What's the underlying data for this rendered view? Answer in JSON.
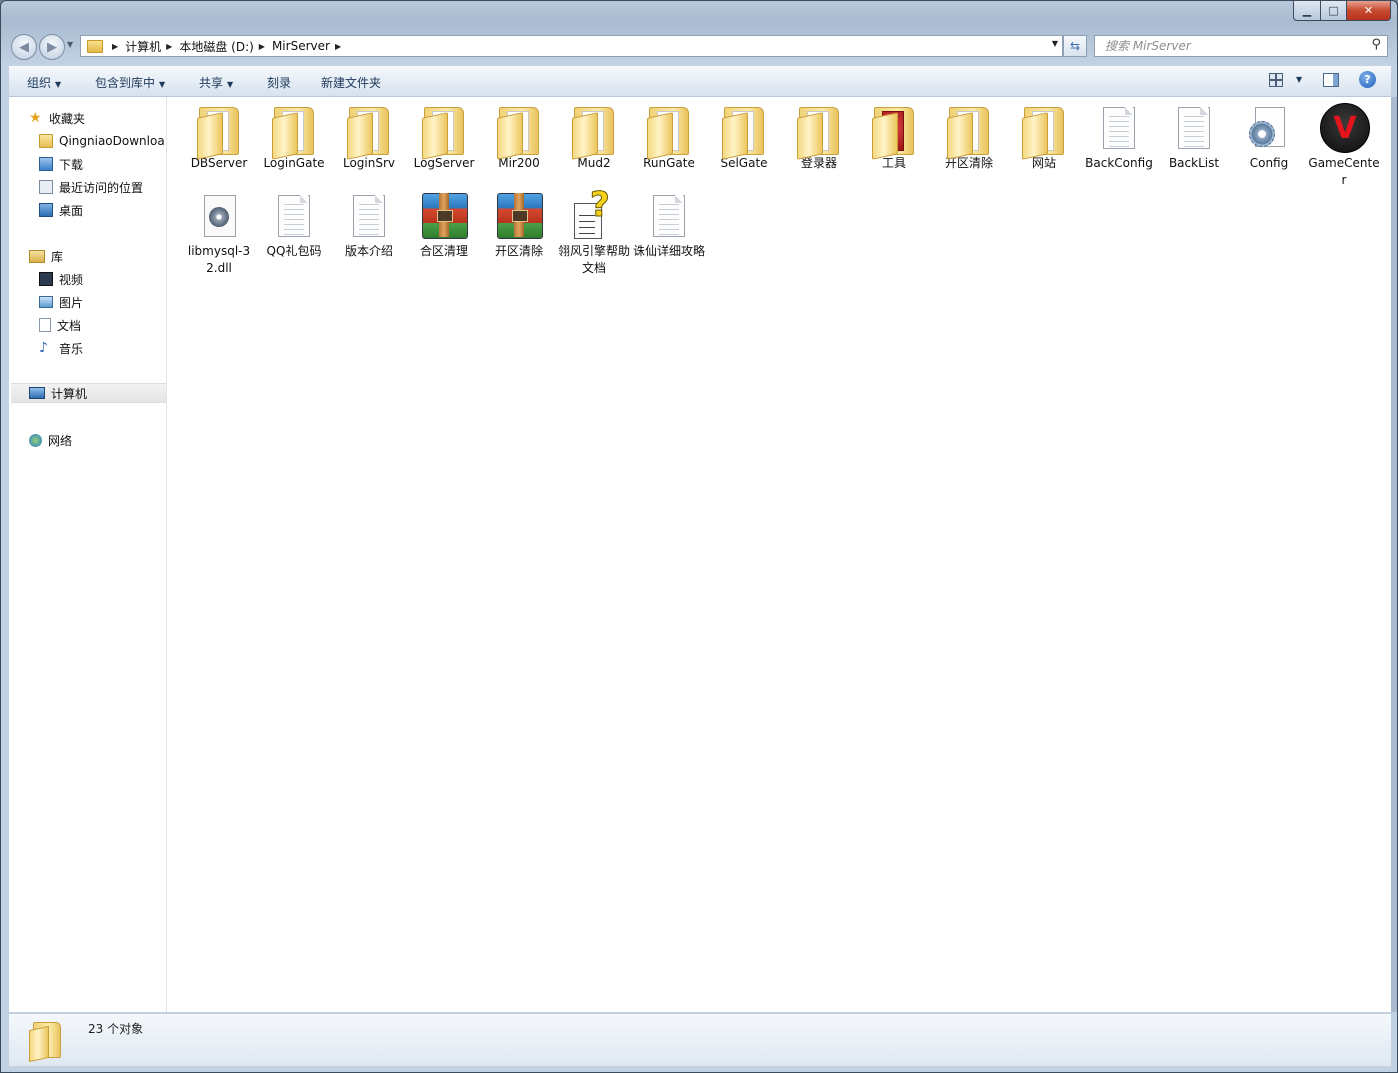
{
  "window": {
    "caption_buttons": {
      "minimize": "▁",
      "maximize": "□",
      "close": "✕"
    }
  },
  "address": {
    "breadcrumbs": [
      "计算机",
      "本地磁盘 (D:)",
      "MirServer"
    ],
    "search_placeholder": "搜索 MirServer"
  },
  "toolbar": {
    "organize": "组织",
    "include_in_library": "包含到库中",
    "share": "共享",
    "burn": "刻录",
    "new_folder": "新建文件夹"
  },
  "sidebar": {
    "favorites": {
      "label": "收藏夹",
      "items": [
        {
          "label": "QingniaoDownloa",
          "icon": "folder-icon"
        },
        {
          "label": "下载",
          "icon": "download-folder-icon"
        },
        {
          "label": "最近访问的位置",
          "icon": "recent-places-icon"
        },
        {
          "label": "桌面",
          "icon": "desktop-icon"
        }
      ]
    },
    "libraries": {
      "label": "库",
      "items": [
        {
          "label": "视频",
          "icon": "video-icon"
        },
        {
          "label": "图片",
          "icon": "picture-icon"
        },
        {
          "label": "文档",
          "icon": "document-icon"
        },
        {
          "label": "音乐",
          "icon": "music-icon"
        }
      ]
    },
    "computer": "计算机",
    "network": "网络"
  },
  "files": [
    {
      "label": "DBServer",
      "type": "folder"
    },
    {
      "label": "LoginGate",
      "type": "folder"
    },
    {
      "label": "LoginSrv",
      "type": "folder"
    },
    {
      "label": "LogServer",
      "type": "folder"
    },
    {
      "label": "Mir200",
      "type": "folder"
    },
    {
      "label": "Mud2",
      "type": "folder"
    },
    {
      "label": "RunGate",
      "type": "folder"
    },
    {
      "label": "SelGate",
      "type": "folder"
    },
    {
      "label": "登录器",
      "type": "folder"
    },
    {
      "label": "工具",
      "type": "folder-red"
    },
    {
      "label": "开区清除",
      "type": "folder"
    },
    {
      "label": "网站",
      "type": "folder"
    },
    {
      "label": "BackConfig",
      "type": "document"
    },
    {
      "label": "BackList",
      "type": "document"
    },
    {
      "label": "Config",
      "type": "config"
    },
    {
      "label": "GameCenter",
      "type": "gamecenter"
    },
    {
      "label": "libmysql-32.dll",
      "type": "dll"
    },
    {
      "label": "QQ礼包码",
      "type": "document"
    },
    {
      "label": "版本介绍",
      "type": "document"
    },
    {
      "label": "合区清理",
      "type": "archive"
    },
    {
      "label": "开区清除",
      "type": "archive"
    },
    {
      "label": "翎风引擎帮助文档",
      "type": "help"
    },
    {
      "label": "诛仙详细攻略",
      "type": "document"
    }
  ],
  "status": {
    "count_text": "23 个对象"
  }
}
